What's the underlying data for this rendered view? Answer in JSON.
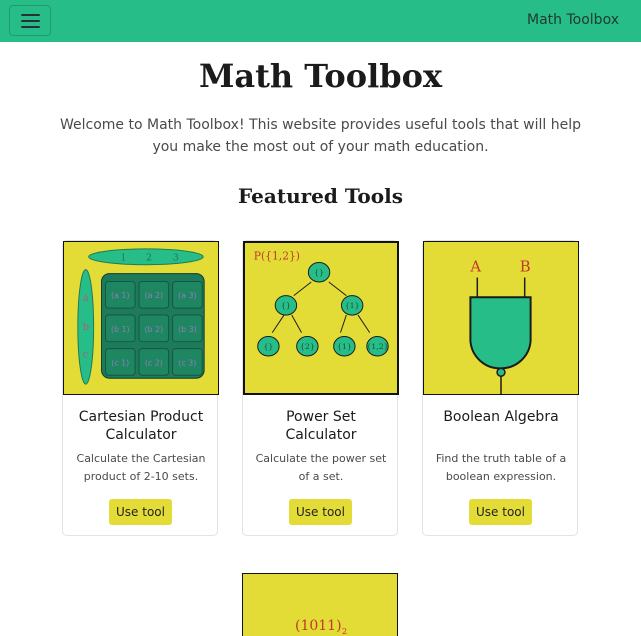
{
  "nav": {
    "brand": "Math Toolbox",
    "menu_icon": "hamburger-menu-icon"
  },
  "page": {
    "title": "Math Toolbox",
    "intro": "Welcome to Math Toolbox! This website provides useful tools that will help you make the most out of your math education.",
    "featured_heading": "Featured Tools"
  },
  "colors": {
    "navbar": "#27bd89",
    "card_image_bg": "#e3dc37",
    "button_bg": "#e3dc37",
    "accent_green": "#27bd89",
    "grid_dark": "#1d7a5b"
  },
  "cards": [
    {
      "title": "Cartesian Product Calculator",
      "text": "Calculate the Cartesian product of 2-10 sets.",
      "button": "Use tool",
      "image": {
        "set_top": [
          "1",
          "2",
          "3"
        ],
        "set_left": [
          "a",
          "b",
          "c"
        ],
        "pairs": [
          [
            "(a 1)",
            "(a 2)",
            "(a 3)"
          ],
          [
            "(b 1)",
            "(b 2)",
            "(b 3)"
          ],
          [
            "(c 1)",
            "(c 2)",
            "(c 3)"
          ]
        ]
      }
    },
    {
      "title": "Power Set Calculator",
      "text": "Calculate the power set of a set.",
      "button": "Use tool",
      "image": {
        "label": "P({1,2})",
        "nodes": [
          "{}",
          "{}",
          "{1}",
          "{}",
          "{2}",
          "{1}",
          "{1,2}"
        ]
      }
    },
    {
      "title": "Boolean Algebra",
      "text": "Find the truth table of a boolean expression.",
      "button": "Use tool",
      "image": {
        "input_a": "A",
        "input_b": "B"
      }
    }
  ],
  "card5_image": {
    "label": "(1011)",
    "subscript": "2"
  }
}
